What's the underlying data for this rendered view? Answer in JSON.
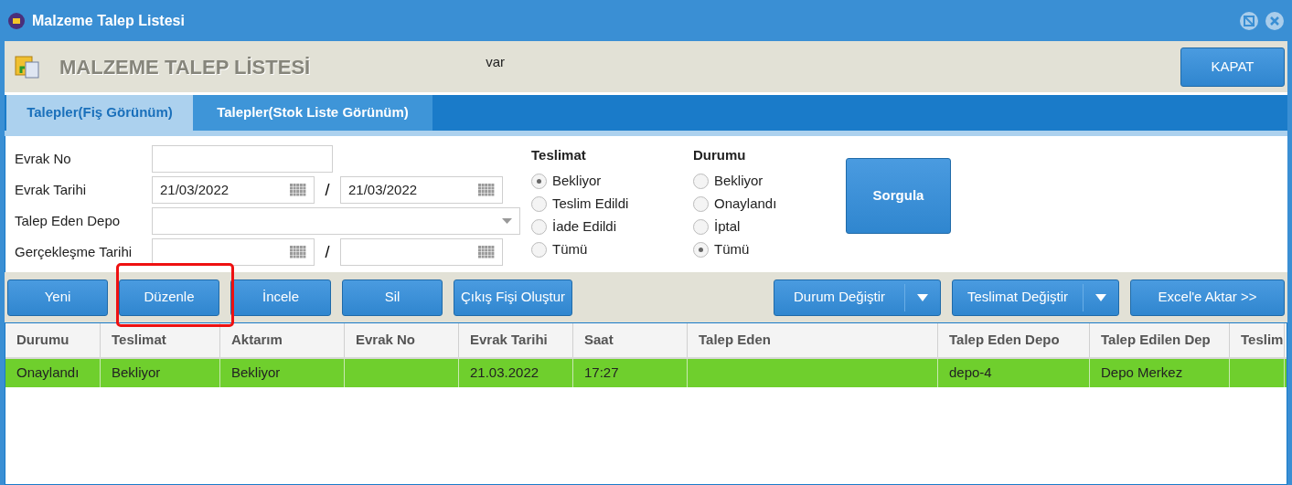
{
  "window": {
    "title": "Malzeme Talep Listesi"
  },
  "header": {
    "title": "MALZEME TALEP LİSTESİ",
    "note": "var",
    "close_button": "KAPAT"
  },
  "tabs": [
    {
      "label": "Talepler(Fiş Görünüm)",
      "selected": true
    },
    {
      "label": "Talepler(Stok Liste Görünüm)",
      "selected": false
    }
  ],
  "filters": {
    "evrak_no": {
      "label": "Evrak No"
    },
    "evrak_tarihi": {
      "label": "Evrak Tarihi",
      "from": "21/03/2022",
      "separator": "/",
      "to": "21/03/2022"
    },
    "talep_eden_depo": {
      "label": "Talep Eden Depo"
    },
    "gerceklesme_tarihi": {
      "label": "Gerçekleşme Tarihi",
      "separator": "/"
    },
    "teslimat": {
      "title": "Teslimat",
      "options": [
        {
          "label": "Bekliyor",
          "selected": true
        },
        {
          "label": "Teslim Edildi",
          "selected": false
        },
        {
          "label": "İade Edildi",
          "selected": false
        },
        {
          "label": "Tümü",
          "selected": false
        }
      ]
    },
    "durumu": {
      "title": "Durumu",
      "options": [
        {
          "label": "Bekliyor",
          "selected": false
        },
        {
          "label": "Onaylandı",
          "selected": false
        },
        {
          "label": "İptal",
          "selected": false
        },
        {
          "label": "Tümü",
          "selected": true
        }
      ]
    },
    "query_button": "Sorgula"
  },
  "toolbar": {
    "left": [
      {
        "label": "Yeni"
      },
      {
        "label": "Düzenle"
      },
      {
        "label": "İncele"
      },
      {
        "label": "Sil"
      },
      {
        "label": "Çıkış Fişi Oluştur"
      }
    ],
    "right": [
      {
        "label": "Durum Değiştir",
        "kind": "split"
      },
      {
        "label": "Teslimat Değiştir",
        "kind": "split"
      },
      {
        "label": "Excel'e Aktar >>",
        "kind": "plain"
      }
    ]
  },
  "table": {
    "columns": [
      "Durumu",
      "Teslimat",
      "Aktarım",
      "Evrak No",
      "Evrak Tarihi",
      "Saat",
      "Talep Eden",
      "Talep Eden Depo",
      "Talep Edilen Dep",
      "Teslim"
    ],
    "rows": [
      {
        "color": "#6fcf2d",
        "cells": [
          "Onaylandı",
          "Bekliyor",
          "Bekliyor",
          null,
          "21.03.2022",
          "17:27",
          null,
          "depo-4",
          "Depo Merkez",
          null
        ]
      }
    ]
  },
  "highlight": {
    "color": "#ee1111"
  }
}
